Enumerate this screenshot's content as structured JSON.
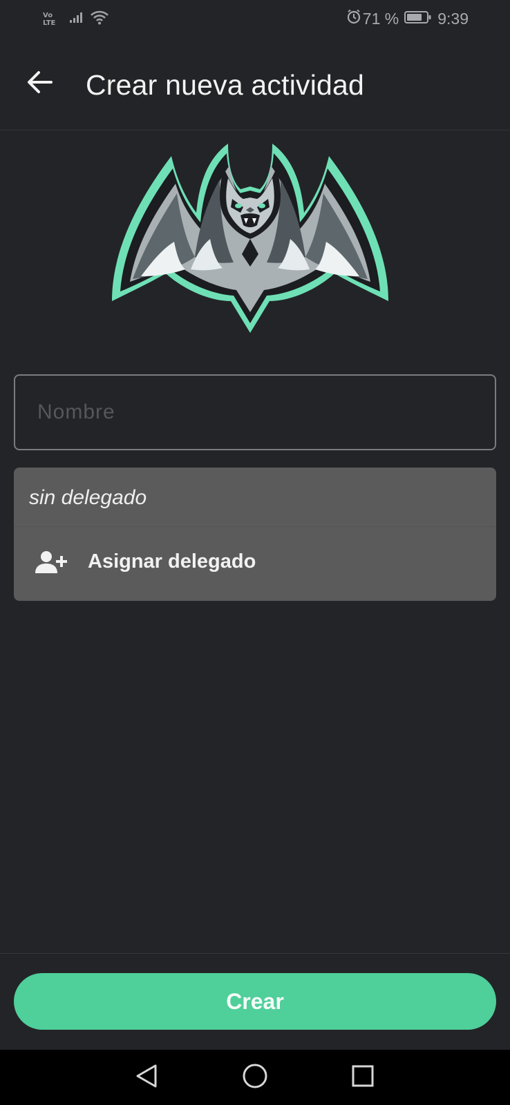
{
  "status_bar": {
    "network_label_top": "Vo",
    "network_label_bottom": "LTE",
    "battery_percent": "71 %",
    "time": "9:39",
    "icons": [
      "signal-icon",
      "wifi-icon",
      "alarm-icon",
      "battery-icon"
    ]
  },
  "app_bar": {
    "title": "Crear nueva actividad",
    "back_icon": "arrow-back-icon"
  },
  "logo": {
    "icon": "bat-logo",
    "outline_color": "#6fe0b6"
  },
  "form": {
    "name_field": {
      "placeholder": "Nombre",
      "value": ""
    },
    "delegate": {
      "status": "sin delegado",
      "assign_label": "Asignar delegado",
      "assign_icon": "person-add-icon"
    }
  },
  "actions": {
    "create_label": "Crear",
    "accent_color": "#4fcf9a"
  },
  "nav_bar": {
    "buttons": [
      "back-triangle-icon",
      "home-circle-icon",
      "recents-square-icon"
    ]
  }
}
